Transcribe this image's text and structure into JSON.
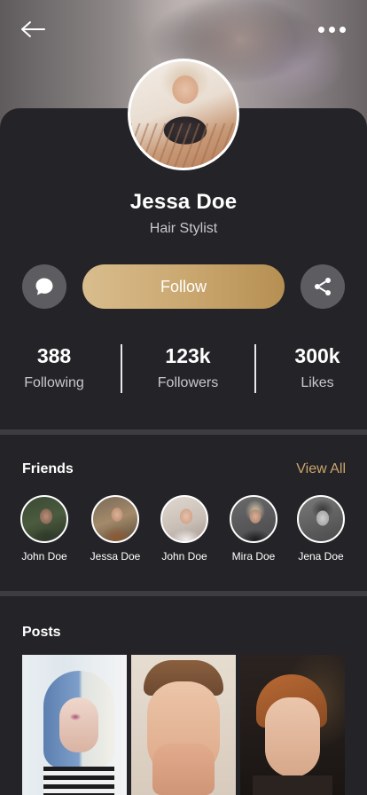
{
  "profile": {
    "name": "Jessa Doe",
    "role": "Hair Stylist"
  },
  "actions": {
    "follow_label": "Follow"
  },
  "stats": [
    {
      "value": "388",
      "label": "Following"
    },
    {
      "value": "123k",
      "label": "Followers"
    },
    {
      "value": "300k",
      "label": "Likes"
    }
  ],
  "friends": {
    "title": "Friends",
    "view_all": "View All",
    "items": [
      {
        "name": "John Doe"
      },
      {
        "name": "Jessa Doe"
      },
      {
        "name": "John Doe"
      },
      {
        "name": "Mira Doe"
      },
      {
        "name": "Jena Doe"
      }
    ]
  },
  "posts": {
    "title": "Posts"
  },
  "icons": {
    "back": "arrow-left-icon",
    "more": "more-horizontal-icon",
    "message": "chat-bubble-icon",
    "share": "share-icon"
  },
  "colors": {
    "background": "#242327",
    "accent": "#c9a66e",
    "button_gray": "#5d5c61"
  }
}
